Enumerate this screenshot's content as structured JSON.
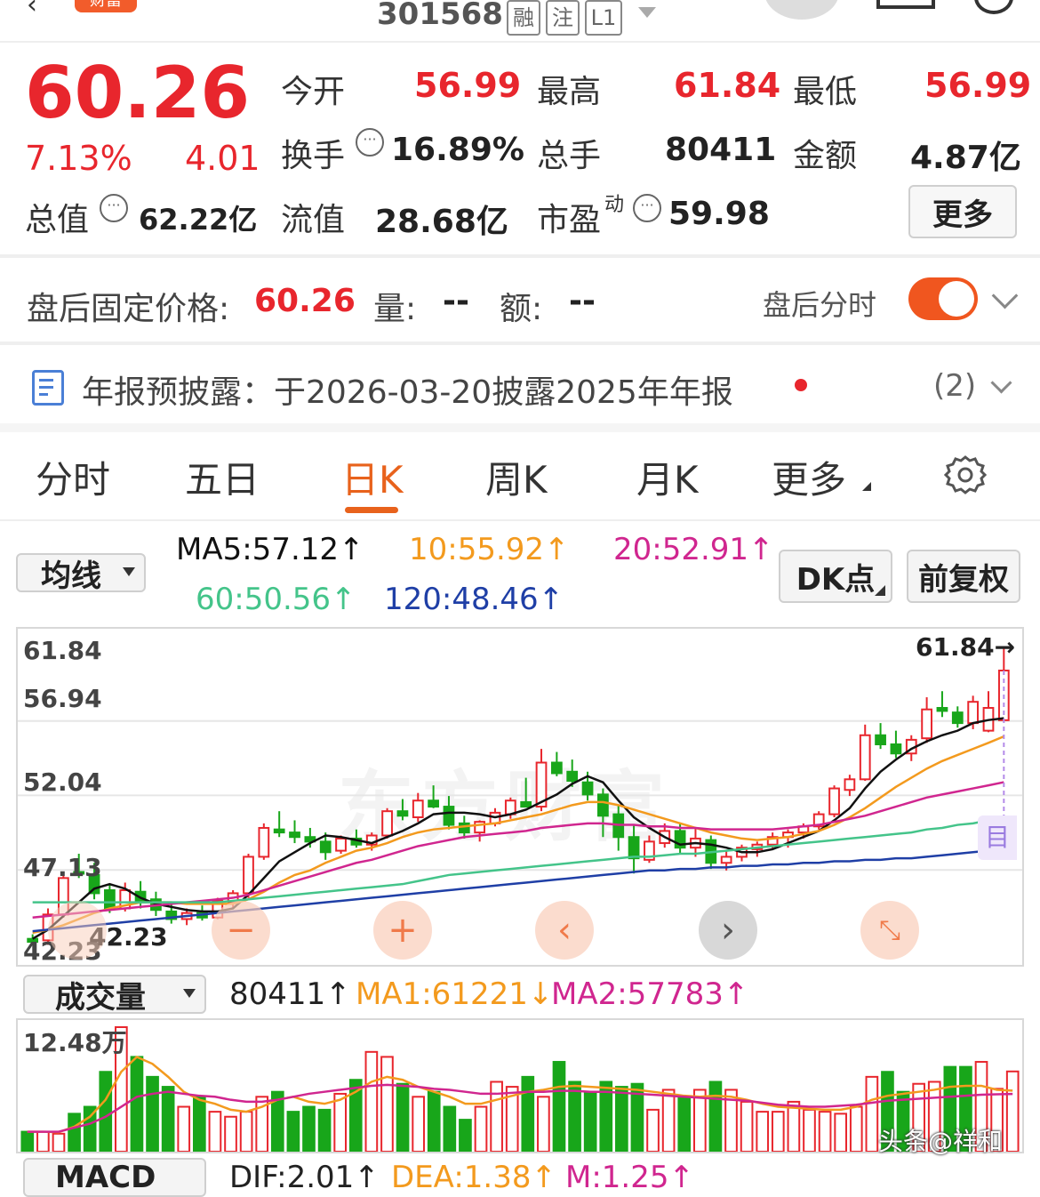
{
  "header": {
    "code": "301568",
    "badges": [
      "融",
      "注",
      "L1"
    ],
    "tag": "财富"
  },
  "quote": {
    "price": "60.26",
    "change_pct": "7.13%",
    "change_amt": "4.01",
    "open_label": "今开",
    "open": "56.99",
    "high_label": "最高",
    "high": "61.84",
    "low_label": "最低",
    "low": "56.99",
    "turnover_label": "换手",
    "turnover": "16.89%",
    "volume_label": "总手",
    "volume": "80411",
    "amount_label": "金额",
    "amount": "4.87亿",
    "mktcap_label": "总值",
    "mktcap": "62.22亿",
    "float_label": "流值",
    "float": "28.68亿",
    "pe_label": "市盈",
    "pe_sup": "动",
    "pe": "59.98",
    "more_label": "更多"
  },
  "afterhours": {
    "label": "盘后固定价格:",
    "price": "60.26",
    "vol_label": "量:",
    "vol": "--",
    "amt_label": "额:",
    "amt": "--",
    "toggle_label": "盘后分时",
    "toggle_on": true
  },
  "notice": {
    "text": "年报预披露：于2026-03-20披露2025年年报",
    "count": "(2)"
  },
  "tabs": [
    "分时",
    "五日",
    "日K",
    "周K",
    "月K",
    "更多"
  ],
  "selected_tab": "日K",
  "indicator": {
    "selector": "均线",
    "ma5": "MA5:57.12↑",
    "ma10": "10:55.92↑",
    "ma20": "20:52.91↑",
    "ma60": "60:50.56↑",
    "ma120": "120:48.46↑",
    "dk_button": "DK点",
    "adjust_button": "前复权"
  },
  "kline": {
    "y_labels": [
      "61.84",
      "56.94",
      "52.04",
      "47.13",
      "42.23"
    ],
    "high_marker": "61.84→",
    "low_marker": "42.23",
    "side_badge": "目",
    "watermark": "东方财富"
  },
  "volume_panel": {
    "selector": "成交量",
    "vol": "80411↑",
    "ma1": "MA1:61221↓",
    "ma2": "MA2:57783↑",
    "max_label": "12.48万"
  },
  "macd_panel": {
    "selector": "MACD",
    "dif": "DIF:2.01↑",
    "dea": "DEA:1.38↑",
    "m": "M:1.25↑"
  },
  "watermark_bottom": "头条@祥和",
  "colors": {
    "up": "#e8262d",
    "down": "#18a61a",
    "accent": "#e8621c",
    "ma5": "#111111",
    "ma10": "#f39a1e",
    "ma20": "#d0268f",
    "ma60": "#44c48a",
    "ma120": "#1f3fa6"
  },
  "chart_data": [
    {
      "type": "candlestick",
      "title": "日K",
      "ylim": [
        42.23,
        61.84
      ],
      "series": [
        {
          "name": "K",
          "ohlc": [
            [
              42.6,
              42.9,
              42.2,
              42.4
            ],
            [
              42.5,
              44.6,
              42.2,
              44.2
            ],
            [
              44.2,
              47.0,
              44.0,
              46.6
            ],
            [
              47.0,
              48.2,
              46.6,
              46.9
            ],
            [
              46.8,
              47.6,
              45.2,
              45.6
            ],
            [
              45.8,
              46.2,
              44.3,
              44.6
            ],
            [
              44.6,
              46.3,
              44.4,
              45.8
            ],
            [
              45.7,
              46.4,
              44.6,
              45.0
            ],
            [
              45.2,
              45.7,
              44.1,
              44.5
            ],
            [
              44.4,
              44.9,
              43.6,
              43.9
            ],
            [
              43.9,
              44.6,
              43.5,
              44.3
            ],
            [
              44.3,
              44.8,
              43.8,
              44.0
            ],
            [
              44.0,
              45.3,
              43.9,
              45.1
            ],
            [
              45.0,
              45.8,
              44.6,
              45.6
            ],
            [
              45.6,
              48.2,
              45.3,
              48.0
            ],
            [
              48.0,
              50.2,
              47.8,
              49.9
            ],
            [
              49.8,
              51.0,
              49.3,
              49.6
            ],
            [
              49.6,
              50.4,
              48.9,
              49.3
            ],
            [
              49.3,
              49.9,
              48.6,
              49.0
            ],
            [
              49.0,
              49.6,
              47.8,
              48.3
            ],
            [
              48.4,
              49.4,
              48.2,
              49.2
            ],
            [
              49.2,
              49.8,
              48.6,
              48.8
            ],
            [
              48.8,
              49.6,
              48.4,
              49.4
            ],
            [
              49.4,
              51.2,
              49.2,
              51.0
            ],
            [
              51.0,
              51.8,
              50.4,
              50.7
            ],
            [
              50.6,
              52.2,
              50.3,
              51.7
            ],
            [
              51.7,
              52.7,
              51.2,
              51.3
            ],
            [
              51.3,
              52.0,
              49.8,
              50.1
            ],
            [
              50.2,
              50.7,
              49.2,
              49.6
            ],
            [
              49.6,
              50.4,
              49.0,
              50.3
            ],
            [
              50.2,
              51.2,
              50.0,
              50.9
            ],
            [
              50.8,
              51.9,
              50.5,
              51.7
            ],
            [
              51.6,
              53.2,
              51.4,
              51.3
            ],
            [
              51.3,
              55.1,
              51.0,
              54.2
            ],
            [
              54.2,
              54.9,
              53.3,
              53.5
            ],
            [
              53.6,
              54.4,
              52.6,
              53.0
            ],
            [
              52.9,
              53.6,
              51.7,
              52.1
            ],
            [
              52.1,
              52.5,
              49.3,
              50.7
            ],
            [
              50.8,
              51.4,
              48.4,
              49.3
            ],
            [
              49.3,
              50.1,
              46.9,
              47.9
            ],
            [
              47.8,
              49.4,
              47.6,
              49.0
            ],
            [
              48.9,
              50.2,
              48.6,
              49.7
            ],
            [
              49.7,
              50.2,
              48.2,
              48.6
            ],
            [
              48.6,
              49.9,
              48.0,
              49.2
            ],
            [
              49.1,
              49.4,
              47.2,
              47.6
            ],
            [
              47.6,
              48.4,
              47.1,
              48.0
            ],
            [
              48.0,
              48.8,
              47.7,
              48.6
            ],
            [
              48.5,
              49.0,
              48.0,
              48.8
            ],
            [
              48.8,
              49.6,
              48.5,
              49.3
            ],
            [
              49.3,
              49.8,
              48.6,
              49.6
            ],
            [
              49.6,
              50.2,
              49.2,
              50.0
            ],
            [
              50.0,
              51.0,
              49.8,
              50.8
            ],
            [
              50.8,
              52.7,
              50.6,
              52.5
            ],
            [
              52.4,
              53.4,
              52.0,
              53.1
            ],
            [
              53.1,
              56.7,
              53.0,
              56.0
            ],
            [
              56.0,
              56.8,
              55.1,
              55.4
            ],
            [
              55.4,
              56.3,
              54.5,
              54.8
            ],
            [
              54.8,
              56.0,
              54.3,
              55.7
            ],
            [
              55.8,
              58.5,
              55.5,
              57.7
            ],
            [
              57.8,
              58.9,
              57.2,
              57.6
            ],
            [
              57.5,
              57.9,
              56.5,
              56.8
            ],
            [
              56.8,
              58.6,
              56.4,
              58.2
            ],
            [
              56.3,
              58.9,
              56.2,
              57.8
            ],
            [
              56.99,
              61.84,
              56.99,
              60.26
            ]
          ]
        },
        {
          "name": "MA5",
          "values": [
            42.6,
            43.2,
            44.1,
            45.0,
            45.9,
            46.2,
            45.9,
            45.3,
            44.9,
            44.7,
            44.5,
            44.4,
            44.4,
            44.6,
            45.5,
            46.6,
            47.7,
            48.3,
            48.9,
            49.4,
            49.3,
            49.1,
            48.9,
            49.3,
            49.7,
            50.2,
            50.8,
            50.9,
            50.9,
            50.8,
            50.6,
            50.8,
            51.1,
            51.6,
            52.1,
            52.8,
            53.3,
            52.9,
            51.7,
            50.6,
            49.9,
            49.3,
            48.8,
            48.9,
            48.8,
            48.6,
            48.3,
            48.3,
            48.5,
            48.9,
            49.3,
            49.7,
            50.4,
            51.2,
            52.5,
            53.6,
            54.4,
            55.1,
            55.6,
            56.0,
            56.3,
            56.8,
            57.0,
            57.12
          ]
        },
        {
          "name": "MA10",
          "values": [
            43.0,
            43.2,
            43.5,
            43.9,
            44.3,
            44.6,
            44.8,
            45.0,
            45.0,
            45.0,
            44.9,
            44.9,
            44.9,
            44.9,
            45.2,
            45.7,
            46.3,
            46.8,
            47.1,
            47.6,
            48.0,
            48.4,
            48.6,
            48.9,
            49.3,
            49.6,
            49.8,
            49.9,
            50.0,
            50.1,
            50.2,
            50.4,
            50.6,
            50.8,
            51.1,
            51.4,
            51.6,
            51.6,
            51.4,
            51.1,
            50.8,
            50.5,
            50.2,
            49.9,
            49.6,
            49.4,
            49.2,
            49.1,
            49.2,
            49.3,
            49.5,
            49.7,
            50.1,
            50.6,
            51.2,
            51.9,
            52.6,
            53.2,
            53.8,
            54.3,
            54.7,
            55.1,
            55.5,
            55.92
          ]
        },
        {
          "name": "MA20",
          "values": [
            44.0,
            44.1,
            44.2,
            44.3,
            44.4,
            44.5,
            44.6,
            44.7,
            44.8,
            44.9,
            45.0,
            45.1,
            45.2,
            45.3,
            45.5,
            45.8,
            46.1,
            46.4,
            46.7,
            47.0,
            47.3,
            47.6,
            47.8,
            48.1,
            48.4,
            48.7,
            48.9,
            49.1,
            49.3,
            49.4,
            49.5,
            49.6,
            49.7,
            49.9,
            50.0,
            50.1,
            50.2,
            50.2,
            50.1,
            50.1,
            50.0,
            50.0,
            49.9,
            49.9,
            49.8,
            49.8,
            49.8,
            49.8,
            49.8,
            49.9,
            50.0,
            50.1,
            50.3,
            50.5,
            50.7,
            51.0,
            51.3,
            51.6,
            51.9,
            52.1,
            52.3,
            52.5,
            52.7,
            52.91
          ]
        },
        {
          "name": "MA60",
          "values": [
            45.0,
            45.0,
            45.0,
            45.0,
            45.0,
            45.0,
            45.0,
            45.0,
            45.0,
            45.0,
            45.0,
            45.0,
            45.0,
            45.1,
            45.2,
            45.3,
            45.4,
            45.5,
            45.6,
            45.7,
            45.8,
            45.9,
            46.0,
            46.1,
            46.2,
            46.4,
            46.6,
            46.8,
            46.9,
            47.0,
            47.1,
            47.2,
            47.3,
            47.4,
            47.5,
            47.6,
            47.7,
            47.8,
            47.9,
            48.0,
            48.0,
            48.1,
            48.2,
            48.2,
            48.3,
            48.4,
            48.5,
            48.6,
            48.7,
            48.8,
            48.9,
            49.0,
            49.1,
            49.2,
            49.3,
            49.4,
            49.5,
            49.6,
            49.8,
            49.9,
            50.1,
            50.2,
            50.4,
            50.56
          ]
        },
        {
          "name": "MA120",
          "values": [
            43.1,
            43.2,
            43.3,
            43.4,
            43.5,
            43.6,
            43.7,
            43.8,
            43.9,
            44.0,
            44.1,
            44.2,
            44.3,
            44.4,
            44.5,
            44.6,
            44.7,
            44.8,
            44.9,
            45.0,
            45.1,
            45.2,
            45.3,
            45.4,
            45.5,
            45.6,
            45.7,
            45.8,
            45.9,
            46.0,
            46.1,
            46.2,
            46.3,
            46.4,
            46.5,
            46.6,
            46.7,
            46.8,
            46.9,
            47.0,
            47.1,
            47.1,
            47.2,
            47.2,
            47.3,
            47.3,
            47.4,
            47.4,
            47.5,
            47.5,
            47.6,
            47.6,
            47.7,
            47.7,
            47.8,
            47.8,
            47.9,
            47.9,
            48.0,
            48.1,
            48.2,
            48.3,
            48.4,
            48.46
          ]
        }
      ]
    },
    {
      "type": "bar",
      "title": "成交量",
      "ylim": [
        0,
        124800
      ],
      "series": [
        {
          "name": "VOL",
          "values": [
            20000,
            20000,
            18000,
            38000,
            45000,
            80000,
            124800,
            95000,
            75000,
            65000,
            45000,
            55000,
            40000,
            35000,
            40000,
            55000,
            60000,
            40000,
            45000,
            42000,
            58000,
            72000,
            100000,
            95000,
            68000,
            55000,
            60000,
            45000,
            32000,
            45000,
            70000,
            65000,
            75000,
            55000,
            90000,
            70000,
            60000,
            70000,
            65000,
            68000,
            42000,
            62000,
            55000,
            62000,
            70000,
            62000,
            50000,
            40000,
            40000,
            50000,
            42000,
            40000,
            38000,
            45000,
            75000,
            80000,
            60000,
            68000,
            70000,
            85000,
            85000,
            90000,
            63000,
            80411
          ]
        },
        {
          "name": "MA1",
          "values": [
            20000,
            20000,
            19500,
            25000,
            35000,
            52000,
            80000,
            95000,
            88000,
            75000,
            60000,
            52000,
            48000,
            42000,
            40000,
            45000,
            52000,
            55000,
            50000,
            48000,
            52000,
            60000,
            70000,
            75000,
            72000,
            65000,
            60000,
            55000,
            48000,
            48000,
            52000,
            56000,
            60000,
            62000,
            65000,
            66000,
            65000,
            64000,
            63000,
            62000,
            60000,
            58000,
            56000,
            55000,
            56000,
            55000,
            52000,
            48000,
            45000,
            44000,
            43000,
            42000,
            42000,
            45000,
            52000,
            56000,
            58000,
            60000,
            62000,
            65000,
            66000,
            66000,
            62000,
            61221
          ]
        },
        {
          "name": "MA2",
          "values": [
            20000,
            20000,
            20000,
            24000,
            28000,
            35000,
            45000,
            55000,
            58000,
            60000,
            58000,
            56000,
            55000,
            52000,
            50000,
            50000,
            52000,
            55000,
            58000,
            60000,
            62000,
            64000,
            66000,
            67000,
            66000,
            65000,
            63000,
            62000,
            60000,
            58000,
            58000,
            59000,
            60000,
            60000,
            61000,
            61000,
            60000,
            60000,
            59000,
            58000,
            57000,
            56000,
            55000,
            54000,
            53000,
            52000,
            51000,
            49000,
            47000,
            46000,
            45000,
            45000,
            46000,
            47000,
            49000,
            51000,
            52000,
            53000,
            54000,
            55000,
            56000,
            57000,
            57500,
            57783
          ]
        }
      ]
    }
  ]
}
